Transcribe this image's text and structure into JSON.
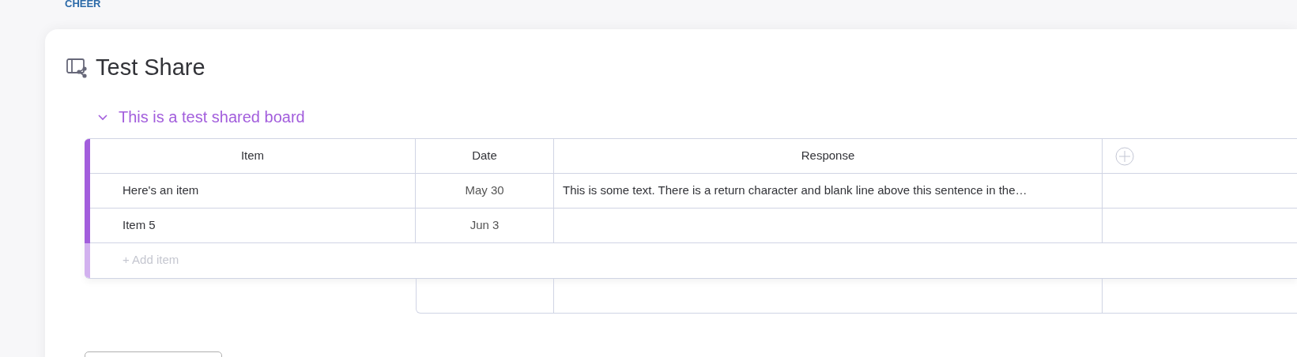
{
  "logo": {
    "text": "CHEER"
  },
  "board": {
    "title": "Test Share"
  },
  "group": {
    "title": "This is a test shared board",
    "expanded": true,
    "color": "#a25ddc"
  },
  "table": {
    "columns": [
      "Item",
      "Date",
      "Response"
    ],
    "rows": [
      {
        "item": "Here's an item",
        "date": "May 30",
        "response": "This is some text. There is a return character and blank line above this sentence in the…"
      },
      {
        "item": "Item 5",
        "date": "Jun 3",
        "response": ""
      }
    ],
    "add_item": {
      "placeholder": "+ Add item"
    }
  }
}
